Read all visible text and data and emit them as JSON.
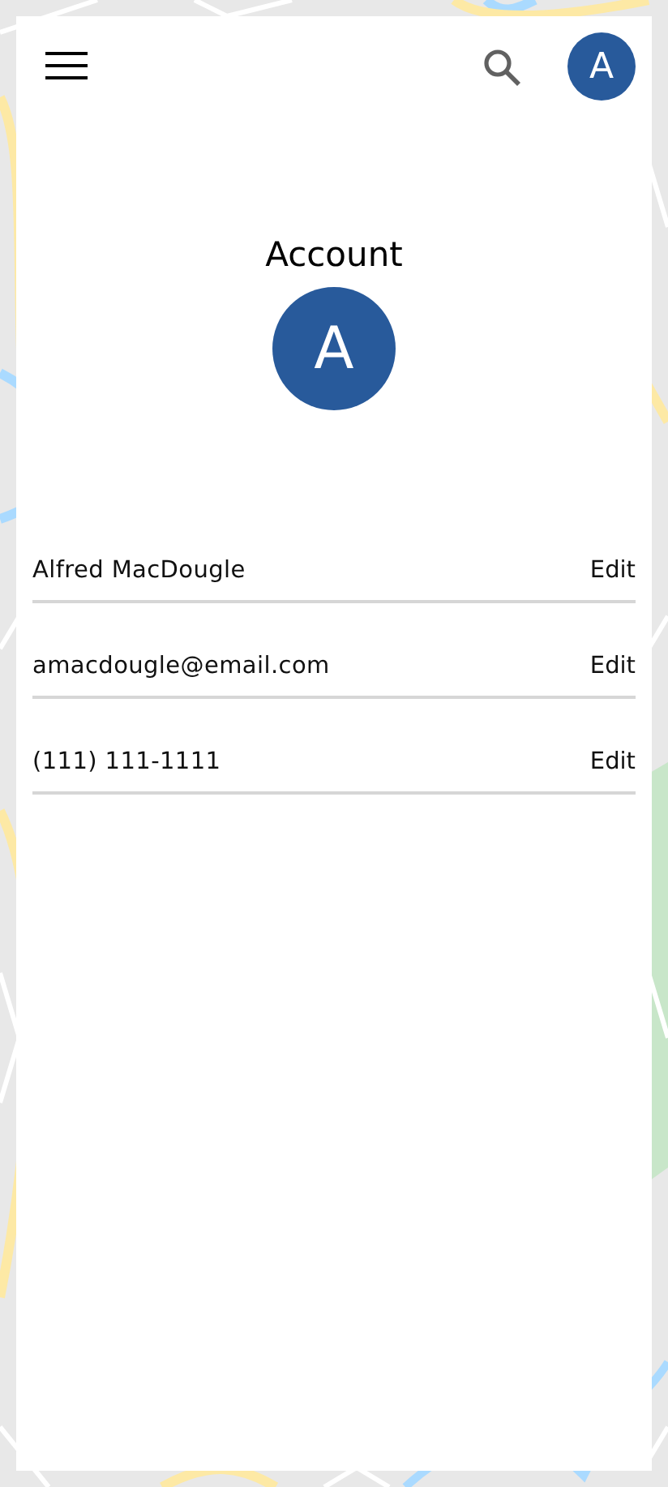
{
  "top_bar": {
    "avatar_letter": "A"
  },
  "title": "Account",
  "avatar_letter": "A",
  "fields": [
    {
      "value": "Alfred MacDougle",
      "action": "Edit"
    },
    {
      "value": "amacdougle@email.com",
      "action": "Edit"
    },
    {
      "value": "(111) 111-1111",
      "action": "Edit"
    }
  ]
}
